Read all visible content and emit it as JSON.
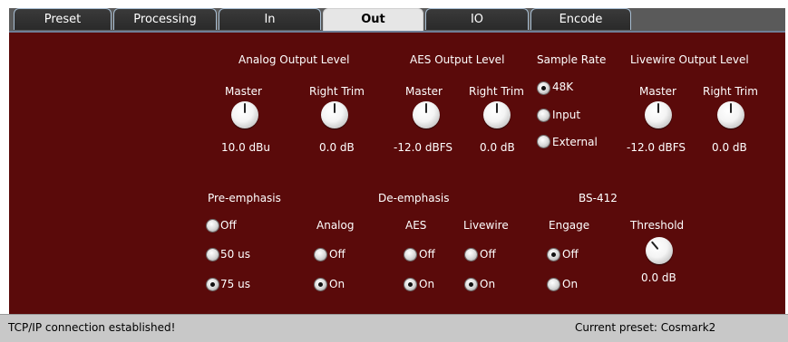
{
  "tabs": [
    "Preset",
    "Processing",
    "In",
    "Out",
    "IO",
    "Encode"
  ],
  "analog_output": {
    "title": "Analog Output Level",
    "master_label": "Master",
    "master_value": "10.0 dBu",
    "trim_label": "Right Trim",
    "trim_value": "0.0 dB"
  },
  "aes_output": {
    "title": "AES Output Level",
    "master_label": "Master",
    "master_value": "-12.0 dBFS",
    "trim_label": "Right Trim",
    "trim_value": "0.0 dB"
  },
  "sample_rate": {
    "title": "Sample Rate",
    "options": [
      "48K",
      "Input",
      "External"
    ],
    "selected": "48K"
  },
  "livewire_output": {
    "title": "Livewire Output Level",
    "master_label": "Master",
    "master_value": "-12.0 dBFS",
    "trim_label": "Right Trim",
    "trim_value": "0.0 dB"
  },
  "pre_emphasis": {
    "title": "Pre-emphasis",
    "options": [
      "Off",
      "50 us",
      "75 us"
    ],
    "selected": "75 us"
  },
  "de_emphasis": {
    "title": "De-emphasis",
    "analog_label": "Analog",
    "aes_label": "AES",
    "livewire_label": "Livewire",
    "options": [
      "Off",
      "On"
    ],
    "analog_selected": "On",
    "aes_selected": "On",
    "livewire_selected": "On"
  },
  "bs412": {
    "title": "BS-412",
    "engage_label": "Engage",
    "engage_options": [
      "Off",
      "On"
    ],
    "engage_selected": "Off",
    "threshold_label": "Threshold",
    "threshold_value": "0.0 dB"
  },
  "status": {
    "left": "TCP/IP connection established!",
    "right": "Current preset: Cosmark2"
  }
}
